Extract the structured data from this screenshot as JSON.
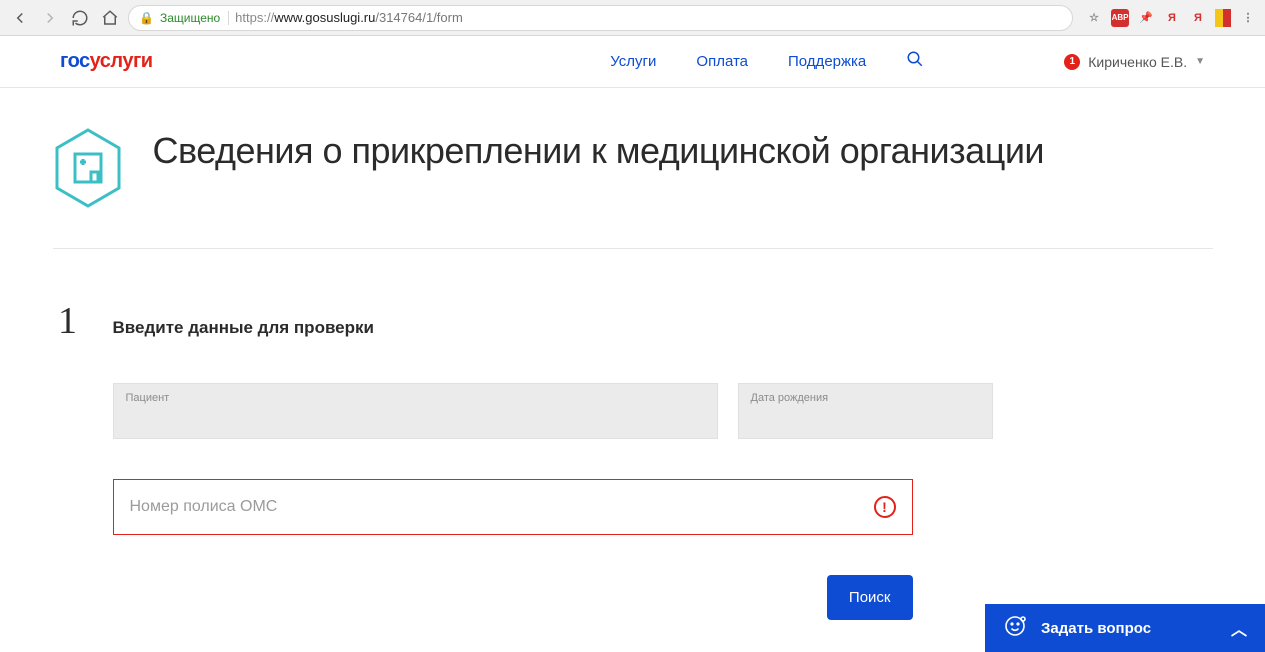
{
  "browser": {
    "secure_label": "Защищено",
    "url_prefix": "https://",
    "url_host": "www.gosuslugi.ru",
    "url_path": "/314764/1/form",
    "notif_count": "1",
    "ext_abp": "ABP",
    "ext_ya": "Я"
  },
  "header": {
    "logo_part1": "гос",
    "logo_part2": "услуги",
    "nav": {
      "services": "Услуги",
      "payment": "Оплата",
      "support": "Поддержка"
    },
    "user_name": "Кириченко Е.В.",
    "notif_count": "1"
  },
  "page": {
    "title": "Сведения о прикреплении к медицинской организации",
    "step_number": "1",
    "step_title": "Введите данные для проверки",
    "fields": {
      "patient_label": "Пациент",
      "dob_label": "Дата рождения",
      "oms_placeholder": "Номер полиса ОМС"
    },
    "submit_label": "Поиск"
  },
  "ask_widget": {
    "label": "Задать вопрос"
  }
}
